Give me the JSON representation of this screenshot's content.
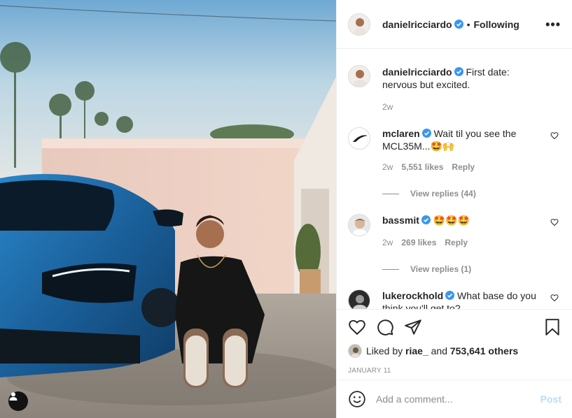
{
  "post": {
    "author": "danielricciardo",
    "follow_status": "Following",
    "separator": "•",
    "more_label": "•••",
    "caption": "First date: nervous but excited.",
    "caption_age": "2w"
  },
  "comments": [
    {
      "username": "mclaren",
      "verified": true,
      "text": "Wait til you see the MCL35M...🤩🙌",
      "age": "2w",
      "likes": "5,551 likes",
      "reply_label": "Reply",
      "view_replies": "View replies (44)"
    },
    {
      "username": "bassmit",
      "verified": true,
      "text": "🤩🤩🤩",
      "age": "2w",
      "likes": "269 likes",
      "reply_label": "Reply",
      "view_replies": "View replies (1)"
    },
    {
      "username": "lukerockhold",
      "verified": true,
      "text": "What base do you think you'll get to?"
    }
  ],
  "likes": {
    "prefix": "Liked by",
    "first_user": "riae_",
    "conjunction": "and",
    "others": "753,641 others"
  },
  "post_date": "JANUARY 11",
  "add_comment": {
    "placeholder": "Add a comment...",
    "post_label": "Post"
  },
  "icons": {
    "like": "heart-icon",
    "comment": "comment-icon",
    "share": "paper-plane-icon",
    "save": "bookmark-icon",
    "emoji": "smiley-icon",
    "more": "ellipsis-icon",
    "verified": "verified-badge-icon",
    "user_tag": "person-icon"
  },
  "colors": {
    "verified_blue": "#3897f0",
    "post_disabled": "#b2dffc",
    "muted_text": "#8e8e8e",
    "border": "#efefef"
  }
}
